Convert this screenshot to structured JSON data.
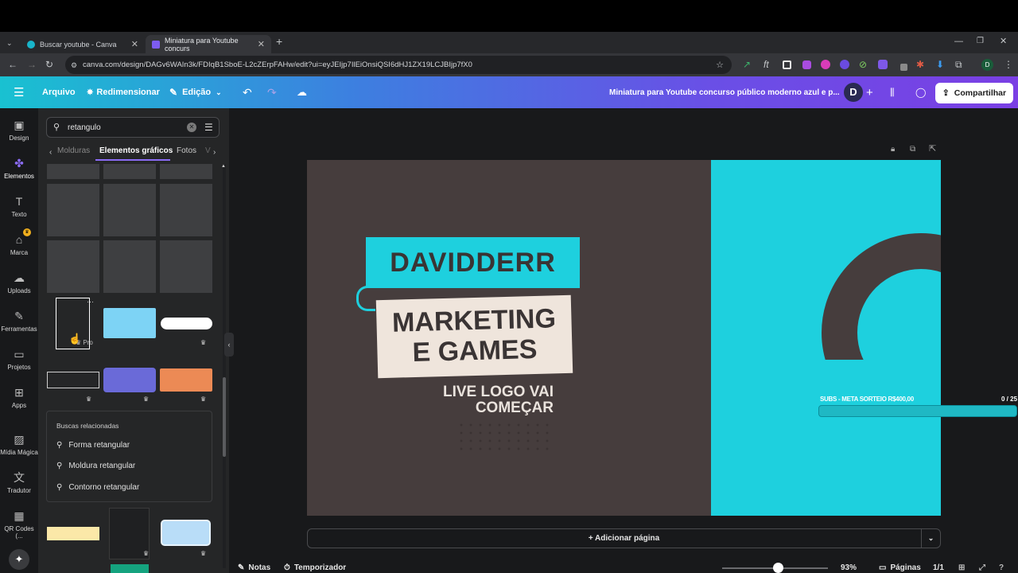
{
  "browser": {
    "tabs": [
      {
        "title": "Buscar youtube - Canva"
      },
      {
        "title": "Miniatura para Youtube concurs"
      }
    ],
    "new_tab": "+",
    "url": "canva.com/design/DAGv6WAIn3k/FDIqB1SboE-L2cZErpFAHw/edit?ui=eyJEIjp7IlEiOnsiQSI6dHJ1ZX19LCJBIjp7fX0"
  },
  "canva_header": {
    "menu": "Arquivo",
    "resize": "Redimensionar",
    "edit": "Edição",
    "doc_title": "Miniatura para Youtube concurso público moderno azul e p...",
    "avatar": "D",
    "share": "Compartilhar"
  },
  "rail": {
    "items": [
      {
        "label": "Design",
        "icon": "design-icon"
      },
      {
        "label": "Elementos",
        "icon": "elements-icon"
      },
      {
        "label": "Texto",
        "icon": "text-icon"
      },
      {
        "label": "Marca",
        "icon": "brand-icon"
      },
      {
        "label": "Uploads",
        "icon": "upload-icon"
      },
      {
        "label": "Ferramentas",
        "icon": "tools-icon"
      },
      {
        "label": "Projetos",
        "icon": "folder-icon"
      },
      {
        "label": "Apps",
        "icon": "apps-icon"
      },
      {
        "label": "Mídia Mágica",
        "icon": "magic-media-icon"
      },
      {
        "label": "Tradutor",
        "icon": "translate-icon"
      },
      {
        "label": "QR Codes (...",
        "icon": "qr-icon"
      }
    ]
  },
  "panel": {
    "search_value": "retangulo",
    "tabs": [
      "Molduras",
      "Elementos gráficos",
      "Fotos",
      "V"
    ],
    "pro_badge": "Pro",
    "related_title": "Buscas relacionadas",
    "related": [
      "Forma retangular",
      "Moldura retangular",
      "Contorno retangular"
    ]
  },
  "design": {
    "title": "DAVIDDERR",
    "subtitle_line1": "MARKETING",
    "subtitle_line2": "E GAMES",
    "live_line1": "LIVE LOGO VAI",
    "live_line2": "COMEÇAR",
    "subs_label": "SUBS - META SORTEIO R$400,00",
    "subs_count": "0  / 25",
    "colors": {
      "dark": "#463d3d",
      "teal": "#1ed0de",
      "cream": "#efe5dc"
    }
  },
  "workspace": {
    "add_page": "+ Adicionar página",
    "notes": "Notas",
    "timer": "Temporizador",
    "zoom": "93%",
    "zoom_value": 0.53,
    "pages_label": "Páginas",
    "pages_value": "1/1"
  }
}
